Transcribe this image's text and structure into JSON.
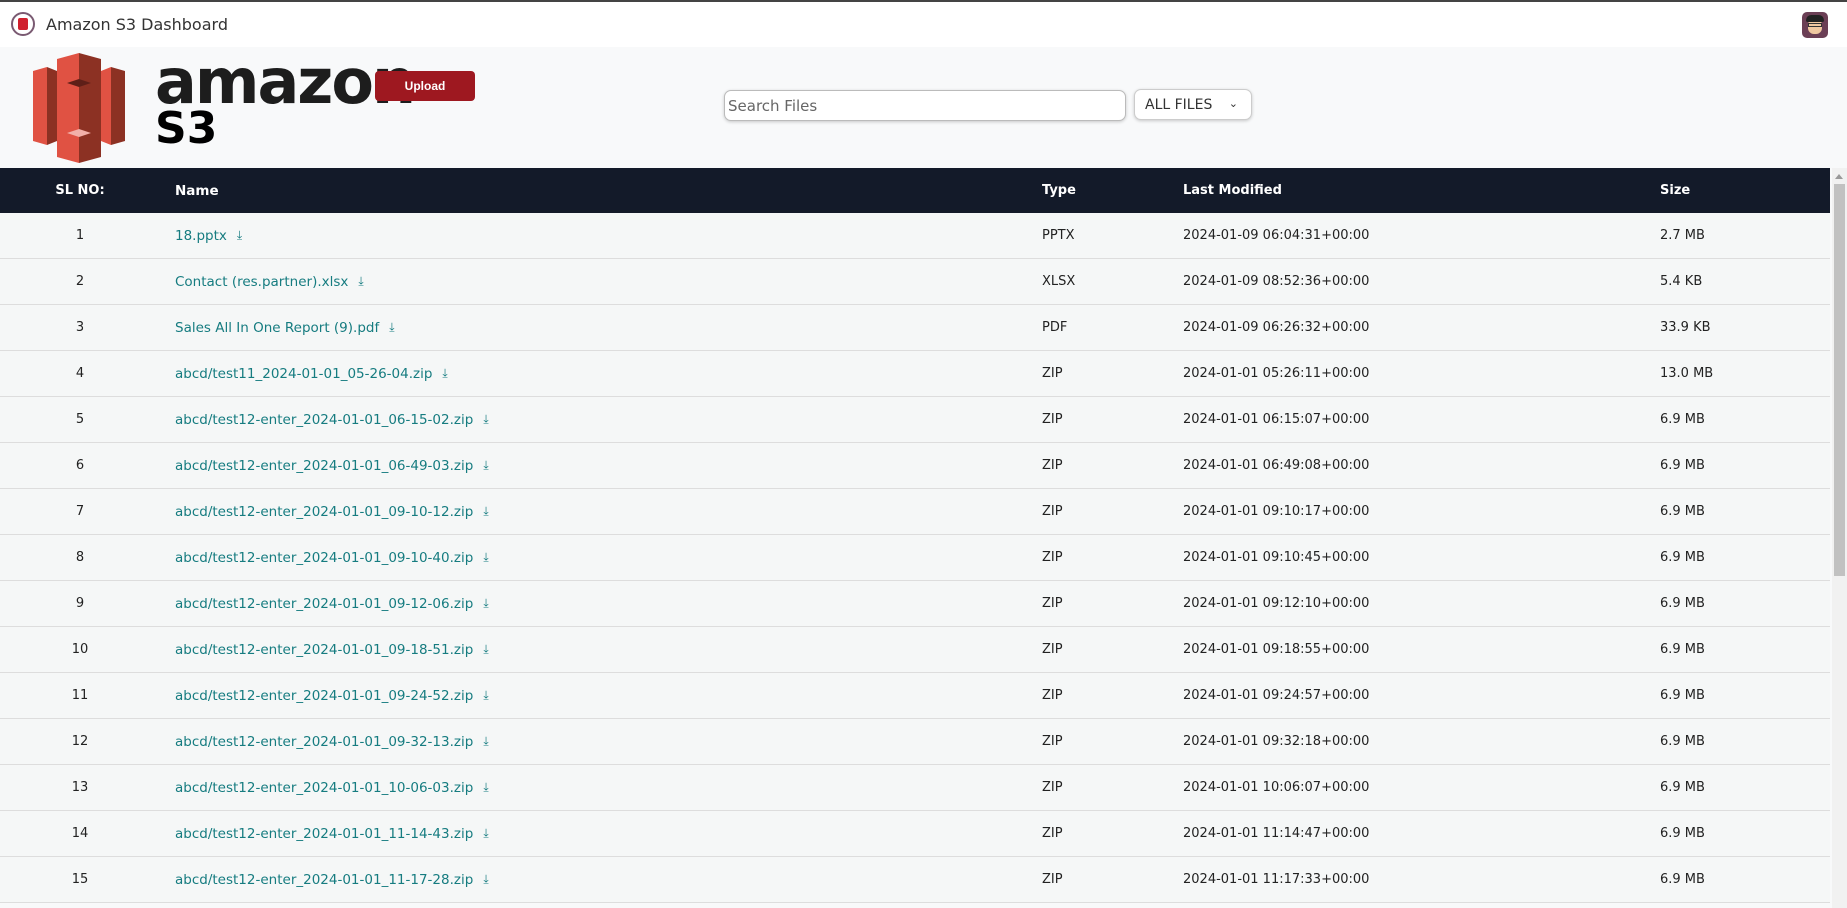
{
  "app": {
    "title": "Amazon S3 Dashboard"
  },
  "header": {
    "logo_text": "amazon S3",
    "upload_label": "Upload",
    "search_placeholder": "Search Files",
    "filter_value": "ALL FILES"
  },
  "colors": {
    "brand": "#9e1820",
    "link": "#167c80",
    "table_header": "#131a29"
  },
  "table": {
    "columns": [
      "SL NO:",
      "Name",
      "Type",
      "Last Modified",
      "Size"
    ],
    "rows": [
      {
        "sl": "1",
        "name": "18.pptx",
        "type": "PPTX",
        "modified": "2024-01-09 06:04:31+00:00",
        "size": "2.7 MB"
      },
      {
        "sl": "2",
        "name": "Contact (res.partner).xlsx",
        "type": "XLSX",
        "modified": "2024-01-09 08:52:36+00:00",
        "size": "5.4 KB"
      },
      {
        "sl": "3",
        "name": "Sales All In One Report (9).pdf",
        "type": "PDF",
        "modified": "2024-01-09 06:26:32+00:00",
        "size": "33.9 KB"
      },
      {
        "sl": "4",
        "name": "abcd/test11_2024-01-01_05-26-04.zip",
        "type": "ZIP",
        "modified": "2024-01-01 05:26:11+00:00",
        "size": "13.0 MB"
      },
      {
        "sl": "5",
        "name": "abcd/test12-enter_2024-01-01_06-15-02.zip",
        "type": "ZIP",
        "modified": "2024-01-01 06:15:07+00:00",
        "size": "6.9 MB"
      },
      {
        "sl": "6",
        "name": "abcd/test12-enter_2024-01-01_06-49-03.zip",
        "type": "ZIP",
        "modified": "2024-01-01 06:49:08+00:00",
        "size": "6.9 MB"
      },
      {
        "sl": "7",
        "name": "abcd/test12-enter_2024-01-01_09-10-12.zip",
        "type": "ZIP",
        "modified": "2024-01-01 09:10:17+00:00",
        "size": "6.9 MB"
      },
      {
        "sl": "8",
        "name": "abcd/test12-enter_2024-01-01_09-10-40.zip",
        "type": "ZIP",
        "modified": "2024-01-01 09:10:45+00:00",
        "size": "6.9 MB"
      },
      {
        "sl": "9",
        "name": "abcd/test12-enter_2024-01-01_09-12-06.zip",
        "type": "ZIP",
        "modified": "2024-01-01 09:12:10+00:00",
        "size": "6.9 MB"
      },
      {
        "sl": "10",
        "name": "abcd/test12-enter_2024-01-01_09-18-51.zip",
        "type": "ZIP",
        "modified": "2024-01-01 09:18:55+00:00",
        "size": "6.9 MB"
      },
      {
        "sl": "11",
        "name": "abcd/test12-enter_2024-01-01_09-24-52.zip",
        "type": "ZIP",
        "modified": "2024-01-01 09:24:57+00:00",
        "size": "6.9 MB"
      },
      {
        "sl": "12",
        "name": "abcd/test12-enter_2024-01-01_09-32-13.zip",
        "type": "ZIP",
        "modified": "2024-01-01 09:32:18+00:00",
        "size": "6.9 MB"
      },
      {
        "sl": "13",
        "name": "abcd/test12-enter_2024-01-01_10-06-03.zip",
        "type": "ZIP",
        "modified": "2024-01-01 10:06:07+00:00",
        "size": "6.9 MB"
      },
      {
        "sl": "14",
        "name": "abcd/test12-enter_2024-01-01_11-14-43.zip",
        "type": "ZIP",
        "modified": "2024-01-01 11:14:47+00:00",
        "size": "6.9 MB"
      },
      {
        "sl": "15",
        "name": "abcd/test12-enter_2024-01-01_11-17-28.zip",
        "type": "ZIP",
        "modified": "2024-01-01 11:17:33+00:00",
        "size": "6.9 MB"
      }
    ]
  }
}
